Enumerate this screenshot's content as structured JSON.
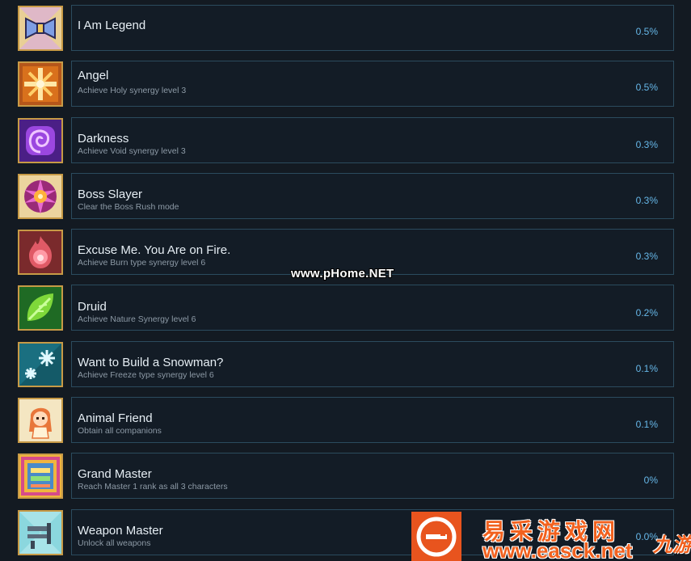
{
  "achievements": [
    {
      "icon": "bowtie-icon",
      "title": "I Am Legend",
      "desc": "",
      "pct": "0.5%"
    },
    {
      "icon": "holy-cross-icon",
      "title": "Angel",
      "desc": "Achieve Holy synergy level 3",
      "pct": "0.5%"
    },
    {
      "icon": "void-spiral-icon",
      "title": "Darkness",
      "desc": "Achieve Void synergy level 3",
      "pct": "0.3%"
    },
    {
      "icon": "boss-emblem-icon",
      "title": "Boss Slayer",
      "desc": "Clear the Boss Rush mode",
      "pct": "0.3%"
    },
    {
      "icon": "flame-icon",
      "title": "Excuse Me. You Are on Fire.",
      "desc": "Achieve Burn type synergy level 6",
      "pct": "0.3%"
    },
    {
      "icon": "leaf-icon",
      "title": "Druid",
      "desc": "Achieve Nature Synergy level 6",
      "pct": "0.2%"
    },
    {
      "icon": "snowflake-icon",
      "title": "Want to Build a Snowman?",
      "desc": "Achieve Freeze type synergy level 6",
      "pct": "0.1%"
    },
    {
      "icon": "companion-girl-icon",
      "title": "Animal Friend",
      "desc": "Obtain all companions",
      "pct": "0.1%"
    },
    {
      "icon": "master-frame-icon",
      "title": "Grand Master",
      "desc": "Reach Master 1 rank as all 3 characters",
      "pct": "0%"
    },
    {
      "icon": "weapons-icon",
      "title": "Weapon Master",
      "desc": "Unlock all weapons",
      "pct": "0.0%"
    }
  ],
  "watermarks": {
    "center": "www.pHome.NET",
    "chinese": "易采游戏网",
    "url": "www.easck.net",
    "side": "九游"
  },
  "colors": {
    "background": "#131a22",
    "card_border": "#2b4b5e",
    "title": "#e6eef4",
    "desc": "#8d9aa6",
    "percent": "#66b7e8",
    "icon_frame": "#c79a46",
    "watermark": "#f2611e"
  }
}
